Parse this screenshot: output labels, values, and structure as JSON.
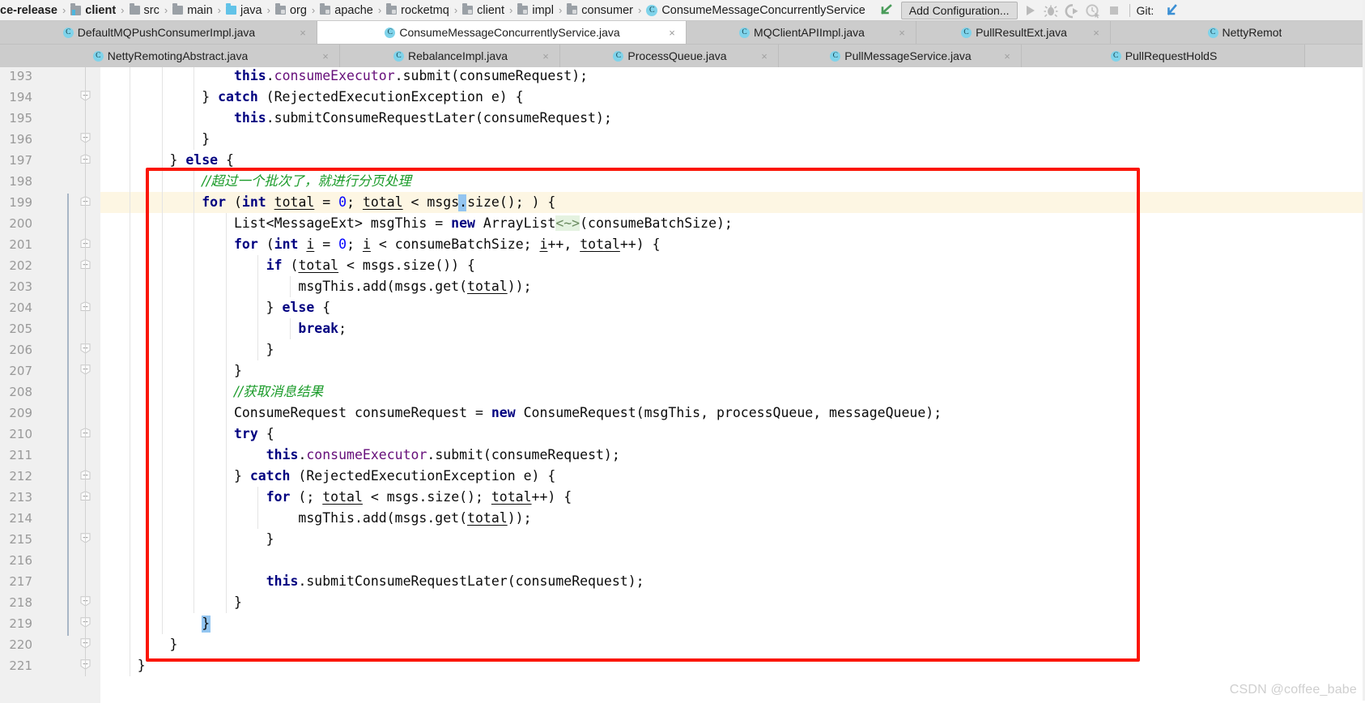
{
  "window": {
    "ide": "IntelliJ IDEA",
    "watermark": "CSDN @coffee_babe"
  },
  "breadcrumb": {
    "items": [
      {
        "label": "ce-release",
        "icon": "none",
        "bold": true
      },
      {
        "label": "client",
        "icon": "module-icon",
        "bold": true
      },
      {
        "label": "src",
        "icon": "folder-icon",
        "bold": false
      },
      {
        "label": "main",
        "icon": "folder-icon",
        "bold": false
      },
      {
        "label": "java",
        "icon": "folder-blue-icon",
        "bold": false
      },
      {
        "label": "org",
        "icon": "package-icon",
        "bold": false
      },
      {
        "label": "apache",
        "icon": "package-icon",
        "bold": false
      },
      {
        "label": "rocketmq",
        "icon": "package-icon",
        "bold": false
      },
      {
        "label": "client",
        "icon": "package-icon",
        "bold": false
      },
      {
        "label": "impl",
        "icon": "package-icon",
        "bold": false
      },
      {
        "label": "consumer",
        "icon": "package-icon",
        "bold": false
      },
      {
        "label": "ConsumeMessageConcurrentlyService",
        "icon": "class-icon",
        "bold": false
      }
    ],
    "separator": "›"
  },
  "toolbar": {
    "back_arrow_icon": "green-arrow-icon",
    "run_configuration": "Add Configuration...",
    "actions": [
      {
        "name": "run-icon",
        "glyph": "run"
      },
      {
        "name": "debug-icon",
        "glyph": "debug"
      },
      {
        "name": "run-with-coverage-icon",
        "glyph": "coverage"
      },
      {
        "name": "profiler-icon",
        "glyph": "profile"
      },
      {
        "name": "stop-icon",
        "glyph": "stop"
      }
    ],
    "git_label": "Git:",
    "git_update_icon": "update-project-icon"
  },
  "editor_tabs": {
    "row1": [
      {
        "label": "DefaultMQPushConsumerImpl.java",
        "active": false,
        "close": "×"
      },
      {
        "label": "ConsumeMessageConcurrentlyService.java",
        "active": true,
        "close": "×"
      },
      {
        "label": "MQClientAPIImpl.java",
        "active": false,
        "close": "×"
      },
      {
        "label": "PullResultExt.java",
        "active": false,
        "close": "×"
      },
      {
        "label": "NettyRemot",
        "active": false,
        "close": ""
      }
    ],
    "row2": [
      {
        "label": "NettyRemotingAbstract.java",
        "active": false,
        "close": "×"
      },
      {
        "label": "RebalanceImpl.java",
        "active": false,
        "close": "×"
      },
      {
        "label": "ProcessQueue.java",
        "active": false,
        "close": "×"
      },
      {
        "label": "PullMessageService.java",
        "active": false,
        "close": "×"
      },
      {
        "label": "PullRequestHoldS",
        "active": false,
        "close": ""
      }
    ]
  },
  "code": {
    "file": "ConsumeMessageConcurrentlyService.java",
    "first_line": 193,
    "current_line": 199,
    "lines": [
      {
        "n": 193,
        "text": "                this.consumeExecutor.submit(consumeRequest);"
      },
      {
        "n": 194,
        "text": "            } catch (RejectedExecutionException e) {"
      },
      {
        "n": 195,
        "text": "                this.submitConsumeRequestLater(consumeRequest);"
      },
      {
        "n": 196,
        "text": "            }"
      },
      {
        "n": 197,
        "text": "        } else {"
      },
      {
        "n": 198,
        "text": "            //超过一个批次了，就进行分页处理"
      },
      {
        "n": 199,
        "text": "            for (int total = 0; total < msgs.size(); ) {"
      },
      {
        "n": 200,
        "text": "                List<MessageExt> msgThis = new ArrayList<~>(consumeBatchSize);"
      },
      {
        "n": 201,
        "text": "                for (int i = 0; i < consumeBatchSize; i++, total++) {"
      },
      {
        "n": 202,
        "text": "                    if (total < msgs.size()) {"
      },
      {
        "n": 203,
        "text": "                        msgThis.add(msgs.get(total));"
      },
      {
        "n": 204,
        "text": "                    } else {"
      },
      {
        "n": 205,
        "text": "                        break;"
      },
      {
        "n": 206,
        "text": "                    }"
      },
      {
        "n": 207,
        "text": "                }"
      },
      {
        "n": 208,
        "text": "                //获取消息结果"
      },
      {
        "n": 209,
        "text": "                ConsumeRequest consumeRequest = new ConsumeRequest(msgThis, processQueue, messageQueue);"
      },
      {
        "n": 210,
        "text": "                try {"
      },
      {
        "n": 211,
        "text": "                    this.consumeExecutor.submit(consumeRequest);"
      },
      {
        "n": 212,
        "text": "                } catch (RejectedExecutionException e) {"
      },
      {
        "n": 213,
        "text": "                    for (; total < msgs.size(); total++) {"
      },
      {
        "n": 214,
        "text": "                        msgThis.add(msgs.get(total));"
      },
      {
        "n": 215,
        "text": "                    }"
      },
      {
        "n": 216,
        "text": ""
      },
      {
        "n": 217,
        "text": "                    this.submitConsumeRequestLater(consumeRequest);"
      },
      {
        "n": 218,
        "text": "                }"
      },
      {
        "n": 219,
        "text": "            }"
      },
      {
        "n": 220,
        "text": "        }"
      },
      {
        "n": 221,
        "text": "    }"
      }
    ],
    "comments": {
      "line198": "//超过一个批次了，就进行分页处理",
      "line208": "//获取消息结果"
    },
    "generic_hint": "<~>",
    "matched_braces": [
      199,
      219
    ]
  },
  "annotation": {
    "shape": "rectangle",
    "color": "#fb1607",
    "covers_lines": "198-220"
  },
  "colors": {
    "keyword": "#000080",
    "number": "#0000ff",
    "field": "#660e7a",
    "comment": "#1a9b29",
    "current_line_bg": "#fdf6e3",
    "brace_match_bg": "#93c5f0",
    "annotation_red": "#fb1607",
    "gutter_bg": "#f0f0f0",
    "tab_bg": "#cccccc",
    "active_tab_bg": "#ffffff"
  }
}
